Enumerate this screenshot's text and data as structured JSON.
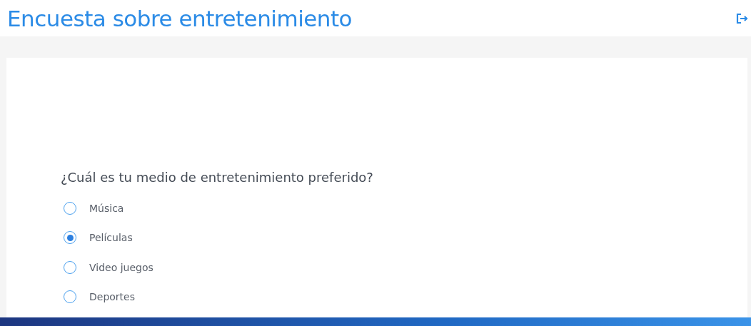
{
  "header": {
    "title": "Encuesta sobre entretenimiento"
  },
  "question": {
    "text": "¿Cuál es tu medio de entretenimiento preferido?",
    "options": [
      {
        "label": "Música",
        "selected": false
      },
      {
        "label": "Películas",
        "selected": true
      },
      {
        "label": "Video juegos",
        "selected": false
      },
      {
        "label": "Deportes",
        "selected": false
      }
    ]
  }
}
